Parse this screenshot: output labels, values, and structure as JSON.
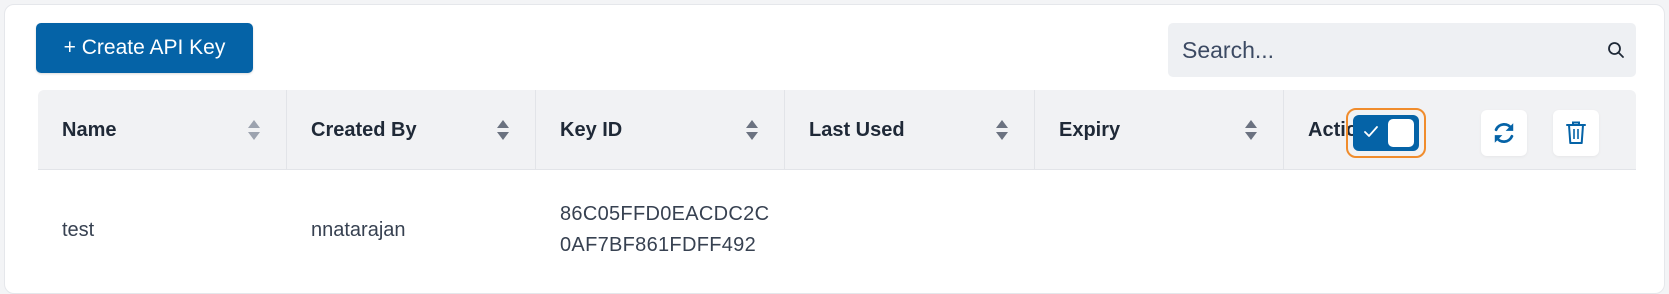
{
  "toolbar": {
    "create_label": "+ Create API Key"
  },
  "search": {
    "placeholder": "Search...",
    "value": ""
  },
  "table": {
    "columns": [
      "Name",
      "Created By",
      "Key ID",
      "Last Used",
      "Expiry",
      "Action"
    ],
    "rows": [
      {
        "name": "test",
        "created_by": "nnatarajan",
        "key_id_line1": "86C05FFD0EACDC2C",
        "key_id_line2": "0AF7BF861FDFF492",
        "last_used": "",
        "expiry": "",
        "enabled": true
      }
    ]
  },
  "icons": {
    "search": "search-icon",
    "refresh": "refresh-icon",
    "delete": "trash-icon",
    "check": "check-icon"
  },
  "colors": {
    "primary": "#0563a7",
    "focus_ring": "#f08c2c",
    "header_bg": "#f1f2f4"
  }
}
